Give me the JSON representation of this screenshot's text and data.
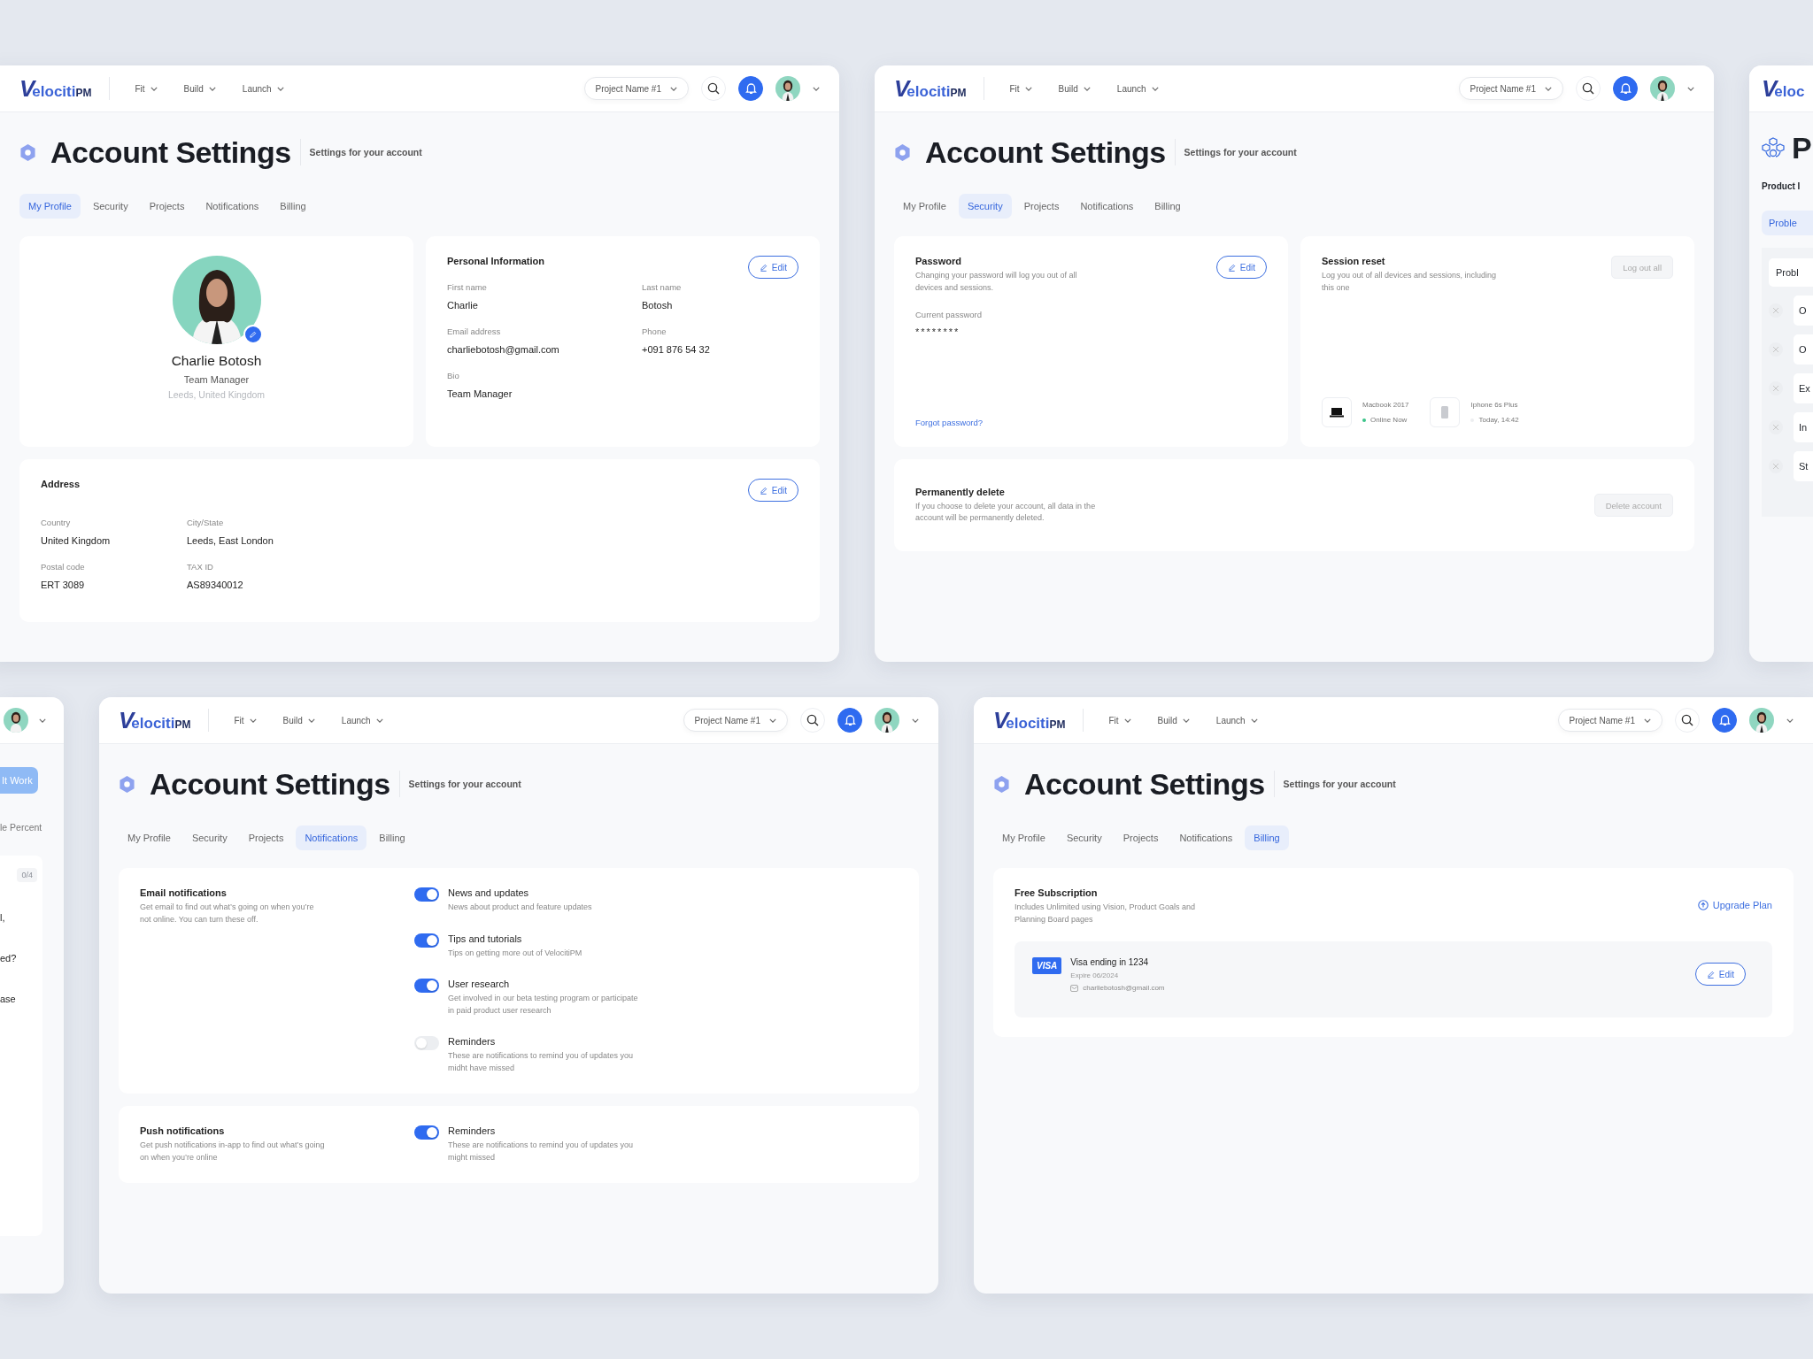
{
  "windows": [
    {
      "kind": "profile",
      "header": {
        "logo": {
          "mark": "V",
          "name": "elociti",
          "suffix": "PM"
        },
        "nav": [
          {
            "label": "Fit"
          },
          {
            "label": "Build"
          },
          {
            "label": "Launch"
          }
        ],
        "project": "Project Name #1"
      },
      "title": "Account Settings",
      "subtitle": "Settings for your account",
      "tabs": [
        {
          "label": "My Profile",
          "selected": true
        },
        {
          "label": "Security",
          "selected": false
        },
        {
          "label": "Projects",
          "selected": false
        },
        {
          "label": "Notifications",
          "selected": false
        },
        {
          "label": "Billing",
          "selected": false
        }
      ],
      "profile": {
        "name": "Charlie Botosh",
        "role": "Team Manager",
        "location": "Leeds, United Kingdom"
      },
      "personal": {
        "title": "Personal Information",
        "edit": "Edit",
        "fields": [
          {
            "label": "First name",
            "value": "Charlie"
          },
          {
            "label": "Last name",
            "value": "Botosh"
          },
          {
            "label": "Email address",
            "value": "charliebotosh@gmail.com"
          },
          {
            "label": "Phone",
            "value": "+091 876 54 32"
          },
          {
            "label": "Bio",
            "value": "Team Manager"
          }
        ]
      },
      "address": {
        "title": "Address",
        "edit": "Edit",
        "fields": [
          {
            "label": "Country",
            "value": "United Kingdom"
          },
          {
            "label": "City/State",
            "value": "Leeds, East London"
          },
          {
            "label": "Postal code",
            "value": "ERT 3089"
          },
          {
            "label": "TAX ID",
            "value": "AS89340012"
          }
        ]
      }
    },
    {
      "kind": "security",
      "header": {
        "logo": {
          "mark": "V",
          "name": "elociti",
          "suffix": "PM"
        },
        "nav": [
          {
            "label": "Fit"
          },
          {
            "label": "Build"
          },
          {
            "label": "Launch"
          }
        ],
        "project": "Project Name #1"
      },
      "title": "Account Settings",
      "subtitle": "Settings for your account",
      "tabs": [
        {
          "label": "My Profile",
          "selected": false
        },
        {
          "label": "Security",
          "selected": true
        },
        {
          "label": "Projects",
          "selected": false
        },
        {
          "label": "Notifications",
          "selected": false
        },
        {
          "label": "Billing",
          "selected": false
        }
      ],
      "password": {
        "title": "Password",
        "text": "Changing your password will log you out of all devices and sessions.",
        "edit": "Edit",
        "field_label": "Current password",
        "value": "********",
        "link": "Forgot password?"
      },
      "session": {
        "title": "Session reset",
        "text": "Log you out of all devices and sessions, including this one",
        "button": "Log out all",
        "devices": [
          {
            "kind": "laptop",
            "name": "Macbook 2017",
            "status": "Online Now",
            "online": true
          },
          {
            "kind": "phone",
            "name": "Iphone 6s Plus",
            "status": "Today, 14:42",
            "online": false
          }
        ]
      },
      "delete": {
        "title": "Permanently delete",
        "text": "If you choose to delete your account, all data in the account will be permanently deleted.",
        "button": "Delete account"
      }
    },
    {
      "kind": "fragment_right",
      "logo": {
        "mark": "V",
        "name": "eloc"
      },
      "title": "P",
      "subtitle": "Product I",
      "tab": "Proble",
      "card_title": "Probl",
      "rows": [
        {
          "label": "O"
        },
        {
          "label": "O"
        },
        {
          "label": "Ex"
        },
        {
          "label": "In"
        },
        {
          "label": "St"
        }
      ]
    },
    {
      "kind": "fragment_left",
      "button": "It Work",
      "caption": "le Percent",
      "counter": "0/4",
      "lines": [
        {
          "label": "l,"
        },
        {
          "label": "ed?"
        },
        {
          "label": "ase"
        }
      ]
    },
    {
      "kind": "notifications",
      "header": {
        "logo": {
          "mark": "V",
          "name": "elociti",
          "suffix": "PM"
        },
        "nav": [
          {
            "label": "Fit"
          },
          {
            "label": "Build"
          },
          {
            "label": "Launch"
          }
        ],
        "project": "Project Name #1"
      },
      "title": "Account Settings",
      "subtitle": "Settings for your account",
      "tabs": [
        {
          "label": "My Profile",
          "selected": false
        },
        {
          "label": "Security",
          "selected": false
        },
        {
          "label": "Projects",
          "selected": false
        },
        {
          "label": "Notifications",
          "selected": true
        },
        {
          "label": "Billing",
          "selected": false
        }
      ],
      "sections": [
        {
          "title": "Email notifications",
          "text": "Get email to find out what’s going on when you’re not online. You can turn these off.",
          "items": [
            {
              "label": "News and updates",
              "text": "News about product and feature updates",
              "on": true
            },
            {
              "label": "Tips and tutorials",
              "text": "Tips on getting more out of VelocitiPM",
              "on": true
            },
            {
              "label": "User research",
              "text": "Get involved in our beta testing program or participate in paid product user research",
              "on": true
            },
            {
              "label": "Reminders",
              "text": "These are notifications to remind you of updates you midht have missed",
              "on": false
            }
          ]
        },
        {
          "title": "Push notifications",
          "text": "Get push notifications in-app to find out what’s going on when you’re online",
          "items": [
            {
              "label": "Reminders",
              "text": "These are notifications to remind you of updates you might missed",
              "on": true
            }
          ]
        }
      ]
    },
    {
      "kind": "billing",
      "header": {
        "logo": {
          "mark": "V",
          "name": "elociti",
          "suffix": "PM"
        },
        "nav": [
          {
            "label": "Fit"
          },
          {
            "label": "Build"
          },
          {
            "label": "Launch"
          }
        ],
        "project": "Project Name #1"
      },
      "title": "Account Settings",
      "subtitle": "Settings for your account",
      "tabs": [
        {
          "label": "My Profile",
          "selected": false
        },
        {
          "label": "Security",
          "selected": false
        },
        {
          "label": "Projects",
          "selected": false
        },
        {
          "label": "Notifications",
          "selected": false
        },
        {
          "label": "Billing",
          "selected": true
        }
      ],
      "plan": {
        "title": "Free Subscription",
        "text": "Includes Unlimited using Vision, Product Goals and Planning Board pages",
        "action": "Upgrade Plan"
      },
      "card": {
        "brand": "VISA",
        "title": "Visa ending in 1234",
        "expiry": "Expire 06/2024",
        "email": "charliebotosh@gmail.com",
        "edit": "Edit"
      }
    }
  ]
}
